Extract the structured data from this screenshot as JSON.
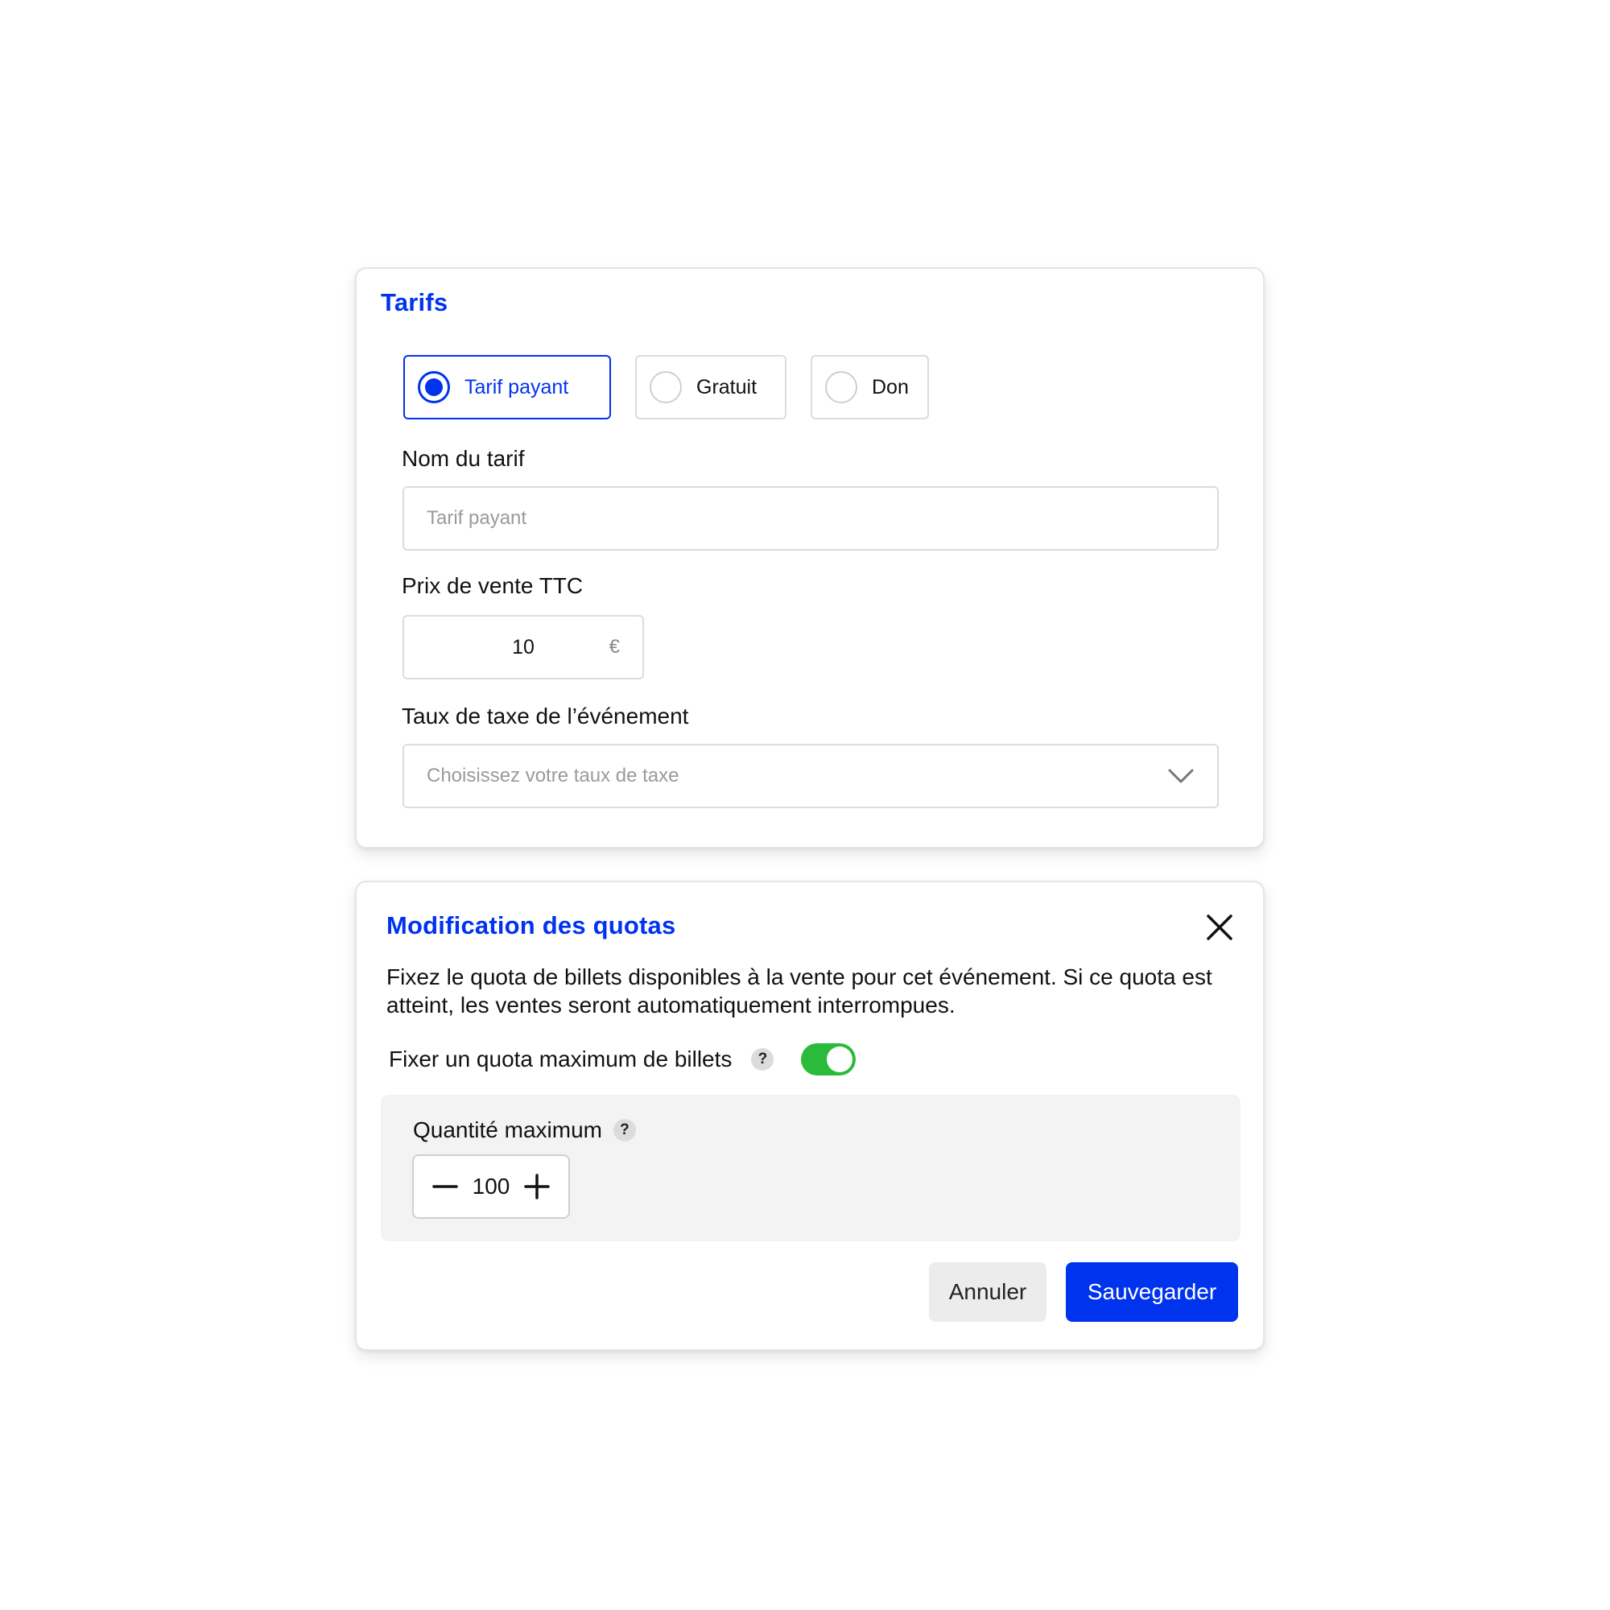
{
  "tarifs": {
    "title": "Tarifs",
    "options": [
      {
        "label": "Tarif payant",
        "selected": true
      },
      {
        "label": "Gratuit",
        "selected": false
      },
      {
        "label": "Don",
        "selected": false
      }
    ],
    "name_label": "Nom du tarif",
    "name_placeholder": "Tarif payant",
    "price_label": "Prix de vente TTC",
    "price_value": "10",
    "currency": "€",
    "tax_label": "Taux de taxe de l’événement",
    "tax_placeholder": "Choisissez votre taux de taxe"
  },
  "quota": {
    "title": "Modification des quotas",
    "description": "Fixez le quota de billets disponibles à la vente pour cet événement. Si ce quota est atteint, les ventes seront automatiquement interrompues.",
    "toggle_label": "Fixer un quota maximum de billets",
    "toggle_on": true,
    "help_glyph": "?",
    "quantity_label": "Quantité maximum",
    "quantity_value": "100",
    "cancel_label": "Annuler",
    "save_label": "Sauvegarder"
  },
  "colors": {
    "accent": "#0033ee",
    "toggle_on": "#2bbb3a",
    "panel_bg": "#f3f3f3"
  }
}
